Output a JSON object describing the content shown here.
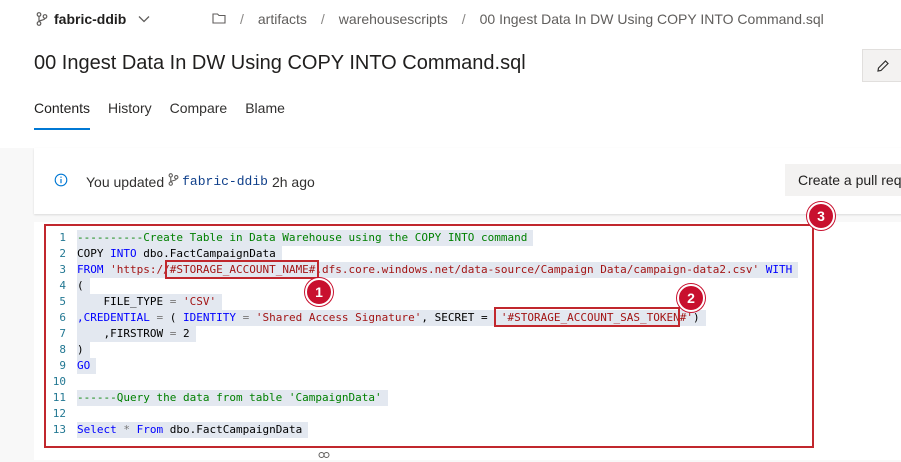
{
  "repo": {
    "name": "fabric-ddib"
  },
  "breadcrumb": [
    "artifacts",
    "warehousescripts",
    "00 Ingest Data In DW Using COPY INTO Command.sql"
  ],
  "file_title": "00 Ingest Data In DW Using COPY INTO Command.sql",
  "tabs": [
    {
      "label": "Contents",
      "active": true
    },
    {
      "label": "History",
      "active": false
    },
    {
      "label": "Compare",
      "active": false
    },
    {
      "label": "Blame",
      "active": false
    }
  ],
  "notice": {
    "prefix": "You updated",
    "branch": "fabric-ddib",
    "time": "2h ago",
    "button": "Create a pull req"
  },
  "code_lines": [
    {
      "n": "1",
      "parts": [
        {
          "t": "----------Create Table in Data Warehouse using the COPY INTO command",
          "c": "cm"
        }
      ]
    },
    {
      "n": "2",
      "parts": [
        {
          "t": "COPY ",
          "c": "tx"
        },
        {
          "t": "INTO",
          "c": "kw"
        },
        {
          "t": " dbo.FactCampaignData",
          "c": "tx"
        }
      ]
    },
    {
      "n": "3",
      "parts": [
        {
          "t": "FROM ",
          "c": "kw"
        },
        {
          "t": "'https://",
          "c": "str"
        },
        {
          "t": "#STORAGE_ACCOUNT_NAME#",
          "c": "str"
        },
        {
          "t": ".dfs.core.windows.net/data-source/Campaign Data/campaign-data2.csv'",
          "c": "str"
        },
        {
          "t": " WITH",
          "c": "kw"
        }
      ]
    },
    {
      "n": "4",
      "parts": [
        {
          "t": "(",
          "c": "tx"
        }
      ]
    },
    {
      "n": "5",
      "parts": [
        {
          "t": "    FILE_TYPE ",
          "c": "tx"
        },
        {
          "t": "=",
          "c": "op"
        },
        {
          "t": " 'CSV'",
          "c": "str"
        }
      ]
    },
    {
      "n": "6",
      "parts": [
        {
          "t": ",CREDENTIAL ",
          "c": "kw"
        },
        {
          "t": "=",
          "c": "op"
        },
        {
          "t": " ( ",
          "c": "tx"
        },
        {
          "t": "IDENTITY",
          "c": "kw"
        },
        {
          "t": " = ",
          "c": "op"
        },
        {
          "t": "'Shared Access Signature'",
          "c": "str"
        },
        {
          "t": ", SECRET = ",
          "c": "tx"
        },
        {
          "t": " '#STORAGE_ACCOUNT_SAS_TOKEN#'",
          "c": "str"
        },
        {
          "t": ")",
          "c": "tx"
        }
      ]
    },
    {
      "n": "7",
      "parts": [
        {
          "t": "    ,FIRSTROW ",
          "c": "tx"
        },
        {
          "t": "=",
          "c": "op"
        },
        {
          "t": " 2",
          "c": "tx"
        }
      ]
    },
    {
      "n": "8",
      "parts": [
        {
          "t": ")",
          "c": "tx"
        }
      ]
    },
    {
      "n": "9",
      "parts": [
        {
          "t": "GO",
          "c": "kw"
        }
      ]
    },
    {
      "n": "10",
      "parts": [
        {
          "t": "",
          "c": "tx"
        }
      ]
    },
    {
      "n": "11",
      "parts": [
        {
          "t": "------Query the data from table 'CampaignData'",
          "c": "cm"
        }
      ]
    },
    {
      "n": "12",
      "parts": [
        {
          "t": "",
          "c": "tx"
        }
      ]
    },
    {
      "n": "13",
      "parts": [
        {
          "t": "Select",
          "c": "kw"
        },
        {
          "t": " * ",
          "c": "op"
        },
        {
          "t": "From",
          "c": "kw"
        },
        {
          "t": " dbo.FactCampaignData",
          "c": "tx"
        }
      ]
    }
  ],
  "callouts": [
    "1",
    "2",
    "3"
  ],
  "icons": {
    "branch": "branch-icon",
    "chevron": "chevron-down-icon",
    "folder": "folder-icon",
    "edit": "pencil-icon",
    "info": "info-icon",
    "link": "link-icon"
  },
  "colors": {
    "accent": "#0078d4",
    "annotation": "#c1272d",
    "code_highlight": "#e3e8f0"
  }
}
